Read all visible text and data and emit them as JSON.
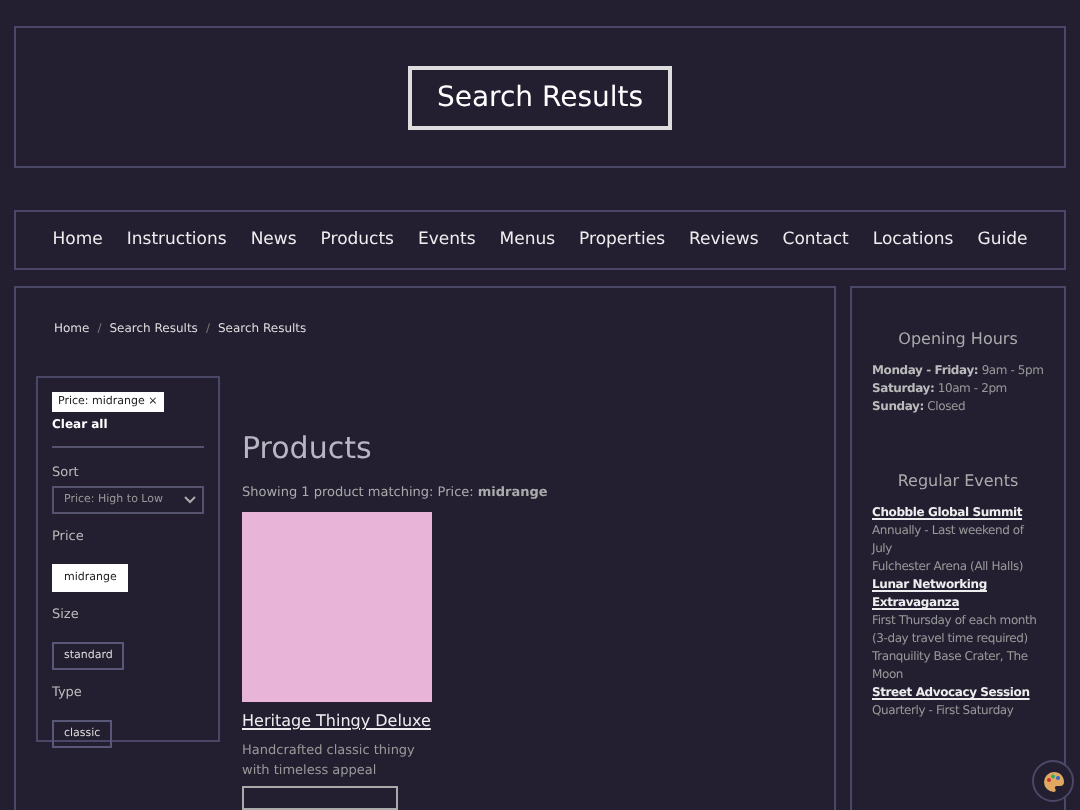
{
  "header": {
    "title": "Search Results"
  },
  "nav": [
    "Home",
    "Instructions",
    "News",
    "Products",
    "Events",
    "Menus",
    "Properties",
    "Reviews",
    "Contact",
    "Locations",
    "Guide"
  ],
  "breadcrumb": [
    "Home",
    "Search Results",
    "Search Results"
  ],
  "breadcrumb_separator": "/",
  "filters": {
    "active_chip": "Price: midrange ×",
    "clear": "Clear all",
    "sort_label": "Sort",
    "sort_value": "Price: High to Low",
    "groups": [
      {
        "label": "Price",
        "options": [
          {
            "label": "midrange",
            "selected": true
          }
        ]
      },
      {
        "label": "Size",
        "options": [
          {
            "label": "standard",
            "selected": false
          }
        ]
      },
      {
        "label": "Type",
        "options": [
          {
            "label": "classic",
            "selected": false
          }
        ]
      }
    ]
  },
  "products": {
    "heading": "Products",
    "summary": "Showing 1 product matching: Price: **midrange**",
    "items": [
      {
        "name": "Heritage Thingy Deluxe",
        "description": "Handcrafted classic thingy with timeless appeal",
        "color": "#e8b4d8"
      }
    ]
  },
  "sidebar": {
    "hours_title": "Opening Hours",
    "hours": [
      {
        "day": "Monday - Friday:",
        "time": "9am - 5pm"
      },
      {
        "day": "Saturday:",
        "time": "10am - 2pm"
      },
      {
        "day": "Sunday:",
        "time": "Closed"
      }
    ],
    "events_title": "Regular Events",
    "events": [
      {
        "name": "Chobble Global Summit",
        "lines": [
          "Annually - Last weekend of July",
          "Fulchester Arena (All Halls)"
        ]
      },
      {
        "name": "Lunar Networking Extravaganza",
        "lines": [
          "First Thursday of each month (3-day travel time required)",
          "Tranquility Base Crater, The Moon"
        ]
      },
      {
        "name": "Street Advocacy Session",
        "lines": [
          "Quarterly - First Saturday"
        ]
      }
    ]
  }
}
